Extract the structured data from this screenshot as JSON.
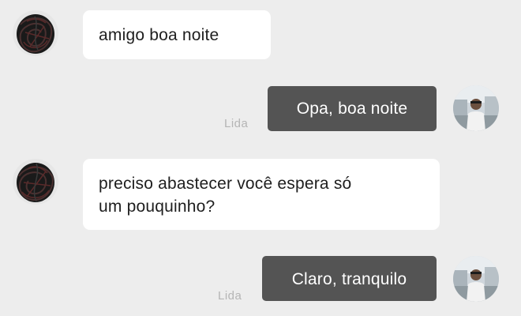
{
  "conversation": {
    "messages": [
      {
        "direction": "incoming",
        "text": "amigo boa noite",
        "avatar": "scribbled-avatar"
      },
      {
        "direction": "outgoing",
        "text": "Opa, boa noite",
        "status": "Lida",
        "avatar": "user-photo-avatar"
      },
      {
        "direction": "incoming",
        "text_lines": [
          "preciso abastecer você espera só",
          "um pouquinho?"
        ],
        "avatar": "scribbled-avatar"
      },
      {
        "direction": "outgoing",
        "text": "Claro, tranquilo",
        "status": "Lida",
        "avatar": "user-photo-avatar"
      }
    ]
  },
  "colors": {
    "background": "#ededed",
    "incoming_bubble": "#ffffff",
    "outgoing_bubble": "#545454",
    "read_status": "#b5b5b5"
  }
}
